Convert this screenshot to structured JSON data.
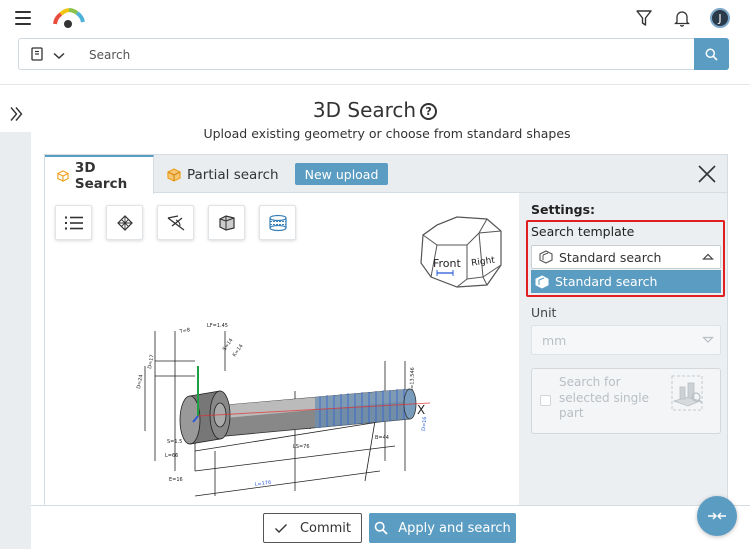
{
  "header": {
    "menu_icon": "hamburger-icon",
    "logo_icon": "gauge-logo-icon",
    "filter_icon": "filter-icon",
    "bell_icon": "bell-icon",
    "avatar_initial": "J"
  },
  "search": {
    "placeholder": "Search",
    "catalog_icon": "catalog-icon",
    "button_icon": "search-icon"
  },
  "page": {
    "title": "3D Search",
    "subtitle": "Upload existing geometry or choose from standard shapes"
  },
  "panel": {
    "tabs": [
      {
        "label": "3D Search",
        "icon": "cube-icon",
        "active": true
      },
      {
        "label": "Partial search",
        "icon": "partial-cube-icon",
        "active": false
      }
    ],
    "new_upload_label": "New upload",
    "tools": [
      "list-icon",
      "mesh-icon",
      "angle-icon",
      "cylinder-icon",
      "layers-icon"
    ],
    "viewcube": {
      "front": "Front",
      "right": "Right"
    }
  },
  "settings": {
    "title": "Settings:",
    "search_template_label": "Search template",
    "search_template_value": "Standard search",
    "search_template_option": "Standard search",
    "unit_label": "Unit",
    "unit_value": "mm",
    "selected_part_label": "Search for selected single part"
  },
  "footer": {
    "commit_label": "Commit",
    "apply_label": "Apply and search"
  },
  "colors": {
    "accent": "#5b9cc3",
    "highlight_border": "#e02020"
  }
}
